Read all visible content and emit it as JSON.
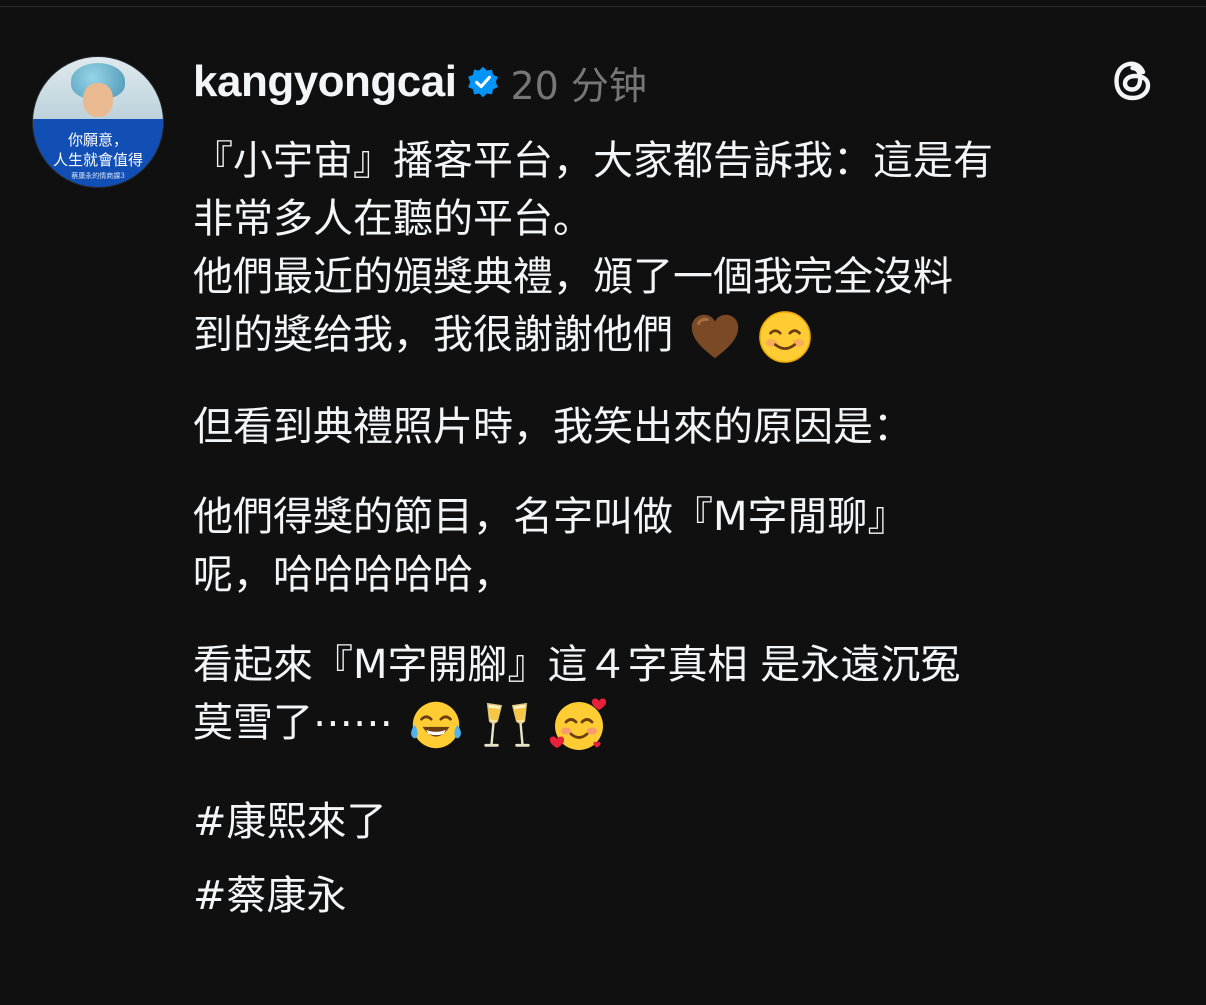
{
  "post": {
    "username": "kangyongcai",
    "timestamp": "20 分钟",
    "avatar_text": {
      "line1": "你願意，",
      "line2": "人生就會值得",
      "line3": "蔡康永的情商課3"
    },
    "paragraphs": [
      {
        "lines": [
          "『小宇宙』播客平台，大家都告訴我：這是有",
          "非常多人在聽的平台。",
          "他們最近的頒獎典禮，頒了一個我完全沒料",
          "到的獎给我，我很謝謝他們"
        ]
      },
      {
        "lines": [
          "但看到典禮照片時，我笑出來的原因是："
        ]
      },
      {
        "lines": [
          "他們得獎的節目，名字叫做『M字閒聊』",
          "呢，哈哈哈哈哈，"
        ]
      },
      {
        "lines": [
          "看起來『M字開腳』這４字真相 是永遠沉冤",
          "莫雪了⋯⋯"
        ]
      }
    ],
    "emoji_names": {
      "p1": [
        "brown-heart-icon",
        "smiling-face-icon"
      ],
      "p4": [
        "tears-of-joy-icon",
        "champagne-glasses-icon",
        "smiling-face-with-hearts-icon"
      ]
    },
    "hashtags": [
      "#康熙來了",
      "#蔡康永"
    ]
  },
  "colors": {
    "background": "#101010",
    "text": "#f3f5f7",
    "muted": "#777777",
    "verified": "#0095f6"
  }
}
